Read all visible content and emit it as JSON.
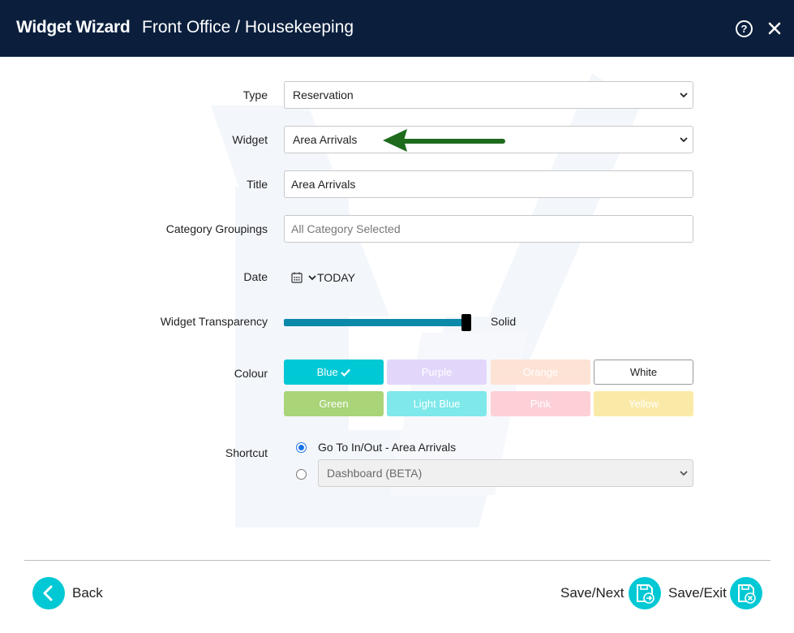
{
  "header": {
    "app_title": "Widget Wizard",
    "sub_title": "Front Office / Housekeeping",
    "help_glyph": "?"
  },
  "form": {
    "type": {
      "label": "Type",
      "value": "Reservation"
    },
    "widget": {
      "label": "Widget",
      "value": "Area Arrivals"
    },
    "title": {
      "label": "Title",
      "value": "Area Arrivals"
    },
    "category_groupings": {
      "label": "Category Groupings",
      "placeholder": "All Category Selected"
    },
    "date": {
      "label": "Date",
      "value": "TODAY"
    },
    "transparency": {
      "label": "Widget Transparency",
      "value_label": "Solid",
      "level": 1.0
    },
    "colour": {
      "label": "Colour",
      "selected": "Blue",
      "options": [
        {
          "label": "Blue",
          "color": "#00c8d4"
        },
        {
          "label": "Purple",
          "color": "#e2d7fb"
        },
        {
          "label": "Orange",
          "color": "#fde3d5"
        },
        {
          "label": "White",
          "color": "#ffffff"
        },
        {
          "label": "Green",
          "color": "#a9d477"
        },
        {
          "label": "Light Blue",
          "color": "#7ee8ea"
        },
        {
          "label": "Pink",
          "color": "#fdd0d8"
        },
        {
          "label": "Yellow",
          "color": "#faeaa7"
        }
      ]
    },
    "shortcut": {
      "label": "Shortcut",
      "option1": "Go To In/Out - Area Arrivals",
      "option2_value": "Dashboard (BETA)"
    }
  },
  "footer": {
    "back_label": "Back",
    "save_next_label": "Save/Next",
    "save_exit_label": "Save/Exit"
  },
  "colors": {
    "header_bg": "#0b1f3d",
    "accent": "#00c8d4",
    "slider": "#0a89a8",
    "annotation_arrow": "#1e6b1e"
  }
}
